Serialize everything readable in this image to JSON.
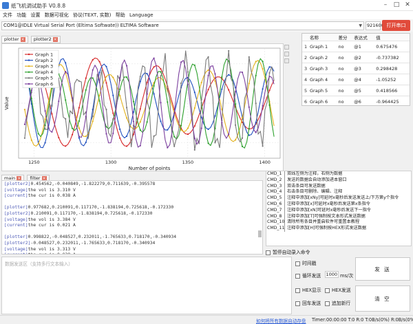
{
  "window": {
    "title": "纸飞机调试助手 V0.8.8"
  },
  "menu": [
    "文件",
    "功能",
    "设置",
    "数据可视化",
    "协议(TEXT, 实数)",
    "帮助",
    "Language"
  ],
  "port": {
    "combo_value": "COM1@IDLE  Virtual Serial Port (Eltima Softwate)) ELTIMA Software",
    "baud_value": "921600",
    "open_button": "打开串口"
  },
  "plot_tabs": [
    "plotter",
    "plotter2"
  ],
  "data_tabs": [
    "main",
    "filter"
  ],
  "chart_data": {
    "type": "line",
    "ylabel": "Value",
    "xlabel": "Number of points",
    "xlim": [
      1240,
      1410
    ],
    "ylim": [
      -1.4,
      1.4
    ],
    "xticks": [
      1250,
      1300,
      1350,
      1400
    ],
    "grid": true,
    "legend_position": "top-left",
    "series": [
      {
        "name": "Graph 1",
        "color": "#d62728",
        "period": 40,
        "phase": 0.0
      },
      {
        "name": "Graph 2",
        "color": "#1f4fbf",
        "period": 27,
        "phase": 1.2
      },
      {
        "name": "Graph 3",
        "color": "#e3b21c",
        "period": 32,
        "phase": 2.5
      },
      {
        "name": "Graph 4",
        "color": "#2ca02c",
        "period": 22,
        "phase": 0.6
      },
      {
        "name": "Graph 5",
        "color": "#7a7a7a",
        "period": 14,
        "phase": 3.1
      },
      {
        "name": "Graph 6",
        "color": "#7b3f9e",
        "period": 19,
        "phase": 4.0
      }
    ]
  },
  "value_table": {
    "headers": [
      "名称",
      "差分",
      "表达式",
      "值"
    ],
    "rows": [
      {
        "idx": "1",
        "name": "Graph 1",
        "diff": "no",
        "expr": "@1",
        "value": "0.675476"
      },
      {
        "idx": "2",
        "name": "Graph 2",
        "diff": "no",
        "expr": "@2",
        "value": "-0.737382"
      },
      {
        "idx": "3",
        "name": "Graph 3",
        "diff": "no",
        "expr": "@3",
        "value": "0.298428"
      },
      {
        "idx": "4",
        "name": "Graph 4",
        "diff": "no",
        "expr": "@4",
        "value": "-1.05252"
      },
      {
        "idx": "5",
        "name": "Graph 5",
        "diff": "no",
        "expr": "@5",
        "value": "0.418566"
      },
      {
        "idx": "6",
        "name": "Graph 6",
        "diff": "no",
        "expr": "@6",
        "value": "-0.964425"
      }
    ]
  },
  "data_lines": [
    {
      "tag": "[plotter2]",
      "rest": "0.454562,-0.040849,-1.822279,0.711639,-0.395578"
    },
    {
      "tag": "[voltage]",
      "rest": "the vol is 3.310 V"
    },
    {
      "tag": "[current]",
      "rest": "the cur is 0.038 A"
    },
    {
      "tag": "",
      "rest": ""
    },
    {
      "tag": "[plotter]",
      "rest": "0.977682,0.210091,0.117170,-1.838194,0.725618,-0.172330"
    },
    {
      "tag": "[plotter2]",
      "rest": "0.210091,0.117170,-1.838194,0.725618,-0.172330"
    },
    {
      "tag": "[voltage]",
      "rest": "the vol is 3.384 V"
    },
    {
      "tag": "[current]",
      "rest": "the cur is 0.021 A"
    },
    {
      "tag": "",
      "rest": ""
    },
    {
      "tag": "[plotter]",
      "rest": "0.998822,-0.048527,0.232011,-1.765633,0.718170,-0.340934"
    },
    {
      "tag": "[plotter2]",
      "rest": "-0.048527,0.232011,-1.765633,0.718170,-0.340934"
    },
    {
      "tag": "[voltage]",
      "rest": "the vol is 3.313 V"
    },
    {
      "tag": "[current]",
      "rest": "the cur is 0.039 A"
    }
  ],
  "commands": [
    {
      "id": "CMD_1",
      "text": "双线左侧为注释，右侧为数据"
    },
    {
      "id": "CMD_2",
      "text": "发送的数据会自动添加进本窗口"
    },
    {
      "id": "CMD_3",
      "text": "双击条目可发送数据"
    },
    {
      "id": "CMD_4",
      "text": "右击条目可删除、编辑、注释"
    },
    {
      "id": "CMD_5",
      "text": "注释中添加[xNy]可延时x毫秒后发送发送上/下方第y个指令"
    },
    {
      "id": "CMD_6",
      "text": "注释中添加[x]可延时x毫秒后发送第x条指令"
    },
    {
      "id": "CMD_7",
      "text": "注释中添加[xN]可延时x毫秒后发送下一指令"
    },
    {
      "id": "CMD_8",
      "text": "注释中添加[T]可强制按文本形式发送数据"
    },
    {
      "id": "CMD_10",
      "text": "清除所有条目并重启软件可重置本教程"
    },
    {
      "id": "CMD_11",
      "text": "注释中添加[H]可强制按HEX形式发送数据"
    }
  ],
  "auto_record_label": "暂停自动录入命令",
  "send": {
    "placeholder": "数据发送区（支持多行文本输入）",
    "timestamp_label": "时间戳",
    "loop_label": "循环发送",
    "interval_value": "1000",
    "interval_unit": "ms/次",
    "hex_display_label": "HEX显示",
    "hex_send_label": "HEX发送",
    "crlf_label": "回车发送",
    "newline_label": "追加新行",
    "send_button": "发 送",
    "clear_button": "清 空"
  },
  "status": {
    "link": "如何将所有数据自动存盘",
    "stats": "Timer:00:00:00  T:0  R:0   T:0B/s(0%)  R:0B/s(0%)"
  }
}
